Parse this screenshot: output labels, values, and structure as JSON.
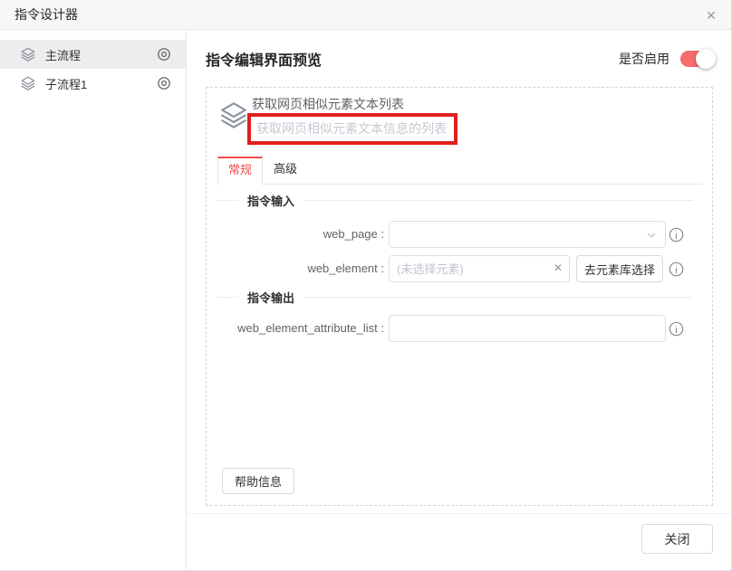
{
  "dialog": {
    "title": "指令设计器"
  },
  "sidebar": {
    "items": [
      {
        "label": "主流程",
        "selected": true
      },
      {
        "label": "子流程1",
        "selected": false
      }
    ]
  },
  "main": {
    "header": "指令编辑界面预览",
    "enable": {
      "label": "是否启用",
      "state": "on"
    },
    "instruction": {
      "title": "获取网页相似元素文本列表",
      "subtitle": "获取网页相似元素文本信息的列表"
    },
    "tabs": [
      {
        "label": "常规",
        "active": true
      },
      {
        "label": "高级",
        "active": false
      }
    ],
    "sections": {
      "input": "指令输入",
      "output": "指令输出"
    },
    "fields": [
      {
        "label": "web_page :",
        "type": "select",
        "value": ""
      },
      {
        "label": "web_element :",
        "type": "input",
        "placeholder": "(未选择元素)",
        "button": "去元素库选择"
      },
      {
        "label": "web_element_attribute_list :",
        "type": "input",
        "value": ""
      }
    ],
    "help_button": "帮助信息"
  },
  "footer": {
    "close_button": "关闭"
  },
  "icons": {
    "close": "✕",
    "clear": "✕",
    "layers": "layers-icon",
    "eye": "eye-icon",
    "chevron_down": "chevron-down-icon",
    "info": "info-icon"
  },
  "colors": {
    "accent_red": "#f24b4b",
    "annotation_red": "#e0201d",
    "toggle_on": "#f56c6c",
    "titlebar_bg": "#f7f7f7",
    "selected_item_bg": "#ededed"
  }
}
